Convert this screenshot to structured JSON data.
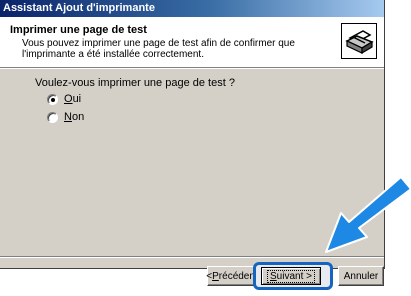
{
  "window": {
    "title": "Assistant Ajout d'imprimante"
  },
  "header": {
    "title": "Imprimer une page de test",
    "description": "Vous pouvez imprimer une page de test afin de confirmer que l'imprimante a été installée correctement.",
    "icon": "printer-icon"
  },
  "body": {
    "question": "Voulez-vous imprimer une page de test ?",
    "options": [
      {
        "mnemonic": "O",
        "rest": "ui",
        "label": "Oui",
        "checked": true
      },
      {
        "mnemonic": "N",
        "rest": "on",
        "label": "Non",
        "checked": false
      }
    ]
  },
  "buttons": {
    "back_prefix": "< ",
    "back_mnemonic": "P",
    "back_rest": "récédent",
    "back_label": "< Précédent",
    "next_mnemonic": "S",
    "next_rest": "uivant >",
    "next_label": "Suivant >",
    "cancel_label": "Annuler"
  },
  "annotation": {
    "arrow_color": "#1e88e5",
    "highlight_color": "#1565c0",
    "target": "next-button"
  }
}
